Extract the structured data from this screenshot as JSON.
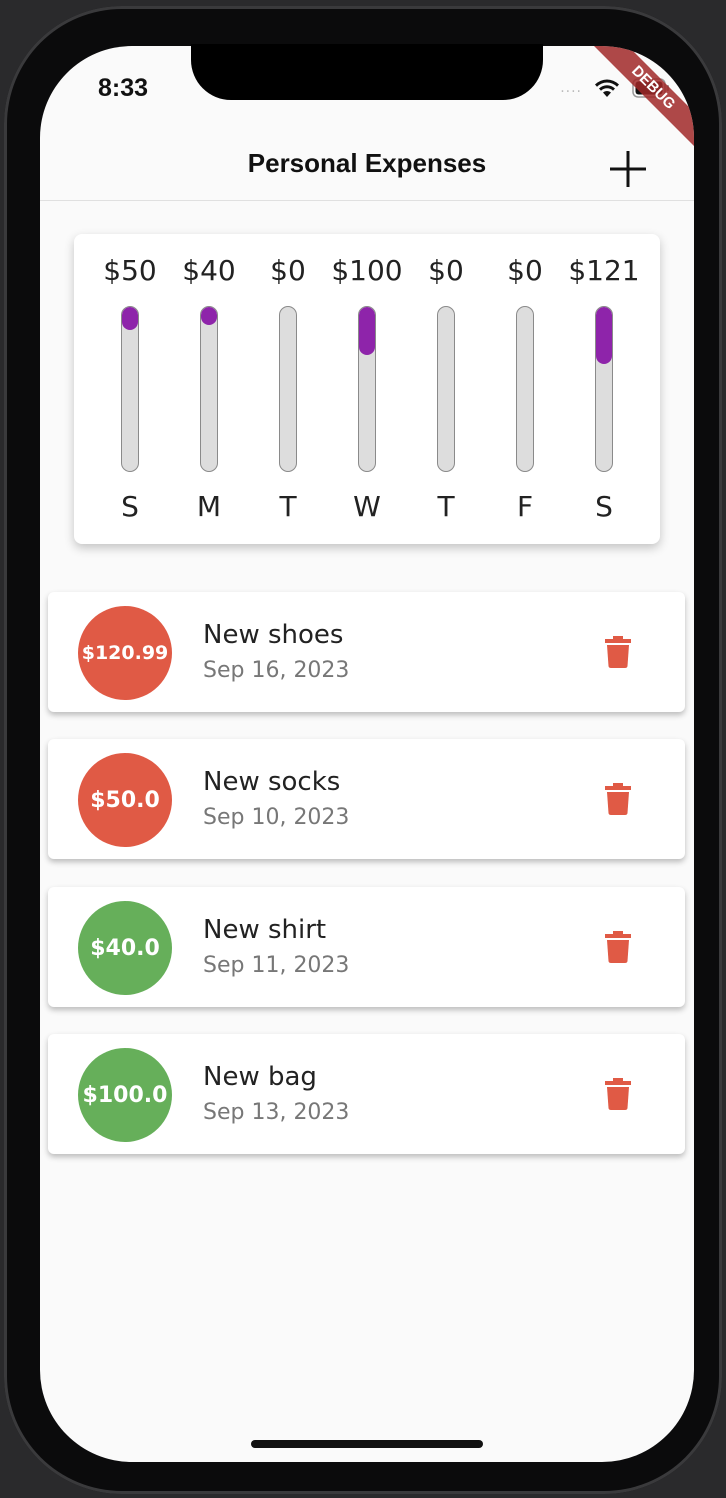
{
  "status_bar": {
    "time": "8:33",
    "signal": "....",
    "debug_label": "DEBUG"
  },
  "app_bar": {
    "title": "Personal Expenses",
    "add_icon": "plus-icon"
  },
  "chart_data": {
    "type": "bar",
    "categories": [
      "S",
      "M",
      "T",
      "W",
      "T",
      "F",
      "S"
    ],
    "values": [
      50,
      40,
      0,
      100,
      0,
      0,
      121
    ],
    "value_labels": [
      "$50",
      "$40",
      "$0",
      "$100",
      "$0",
      "$0",
      "$121"
    ],
    "fill_fraction": [
      0.14,
      0.11,
      0,
      0.29,
      0,
      0,
      0.35
    ],
    "fill_color": "#8e24aa",
    "track_color": "#dddddd"
  },
  "transactions": [
    {
      "amount": "$120.99",
      "title": "New shoes",
      "date": "Sep 16, 2023",
      "color": "#e05a45"
    },
    {
      "amount": "$50.0",
      "title": "New socks",
      "date": "Sep 10, 2023",
      "color": "#e05a45"
    },
    {
      "amount": "$40.0",
      "title": "New shirt",
      "date": "Sep 11, 2023",
      "color": "#66af5a"
    },
    {
      "amount": "$100.0",
      "title": "New bag",
      "date": "Sep 13, 2023",
      "color": "#66af5a"
    }
  ],
  "delete_icon": "trash-icon",
  "delete_color": "#e05a45"
}
